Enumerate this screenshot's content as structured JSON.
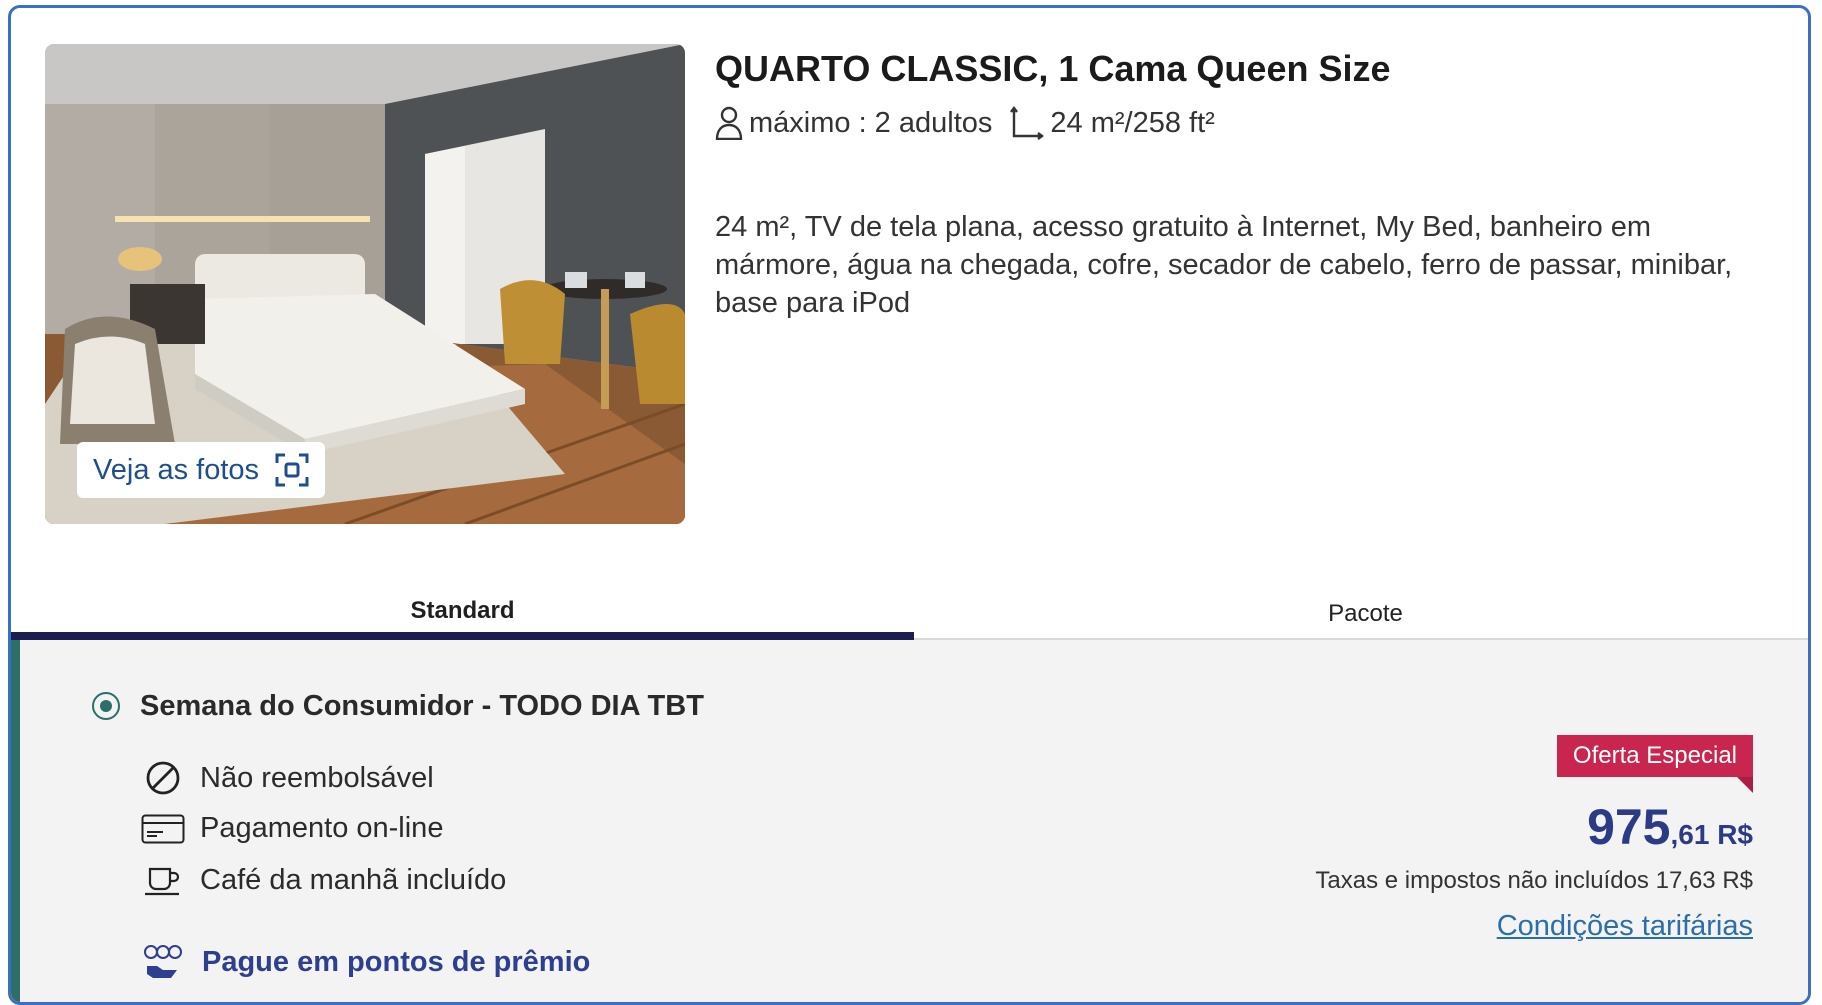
{
  "room": {
    "title": "QUARTO CLASSIC, 1 Cama Queen Size",
    "occupancy": "máximo : 2 adultos",
    "size": "24 m²/258 ft²",
    "description": "24 m², TV de tela plana, acesso gratuito à Internet, My Bed, banheiro em mármore, água na chegada, cofre, secador de cabelo, ferro de passar, minibar, base para iPod",
    "photos_button": "Veja as fotos"
  },
  "tabs": [
    {
      "label": "Standard",
      "active": true
    },
    {
      "label": "Pacote",
      "active": false
    }
  ],
  "rate": {
    "name": "Semana do Consumidor - TODO DIA TBT",
    "selected": true,
    "features": [
      {
        "icon": "no-refund-icon",
        "label": "Não reembolsável"
      },
      {
        "icon": "credit-card-icon",
        "label": "Pagamento on-line"
      },
      {
        "icon": "coffee-cup-icon",
        "label": "Café da manhã incluído"
      }
    ],
    "points_link": "Pague em pontos de prêmio",
    "badge": "Oferta Especial",
    "price_main": "975",
    "price_cents": ",61 R$",
    "taxes": "Taxas e impostos não incluídos 17,63 R$",
    "conditions_link": "Condições tarifárias"
  },
  "colors": {
    "border": "#3a6fc4",
    "tab_active": "#1a1f4f",
    "rate_accent": "#2f6e67",
    "badge": "#c8264f",
    "price": "#2b3b85",
    "link": "#2b6ea8"
  }
}
